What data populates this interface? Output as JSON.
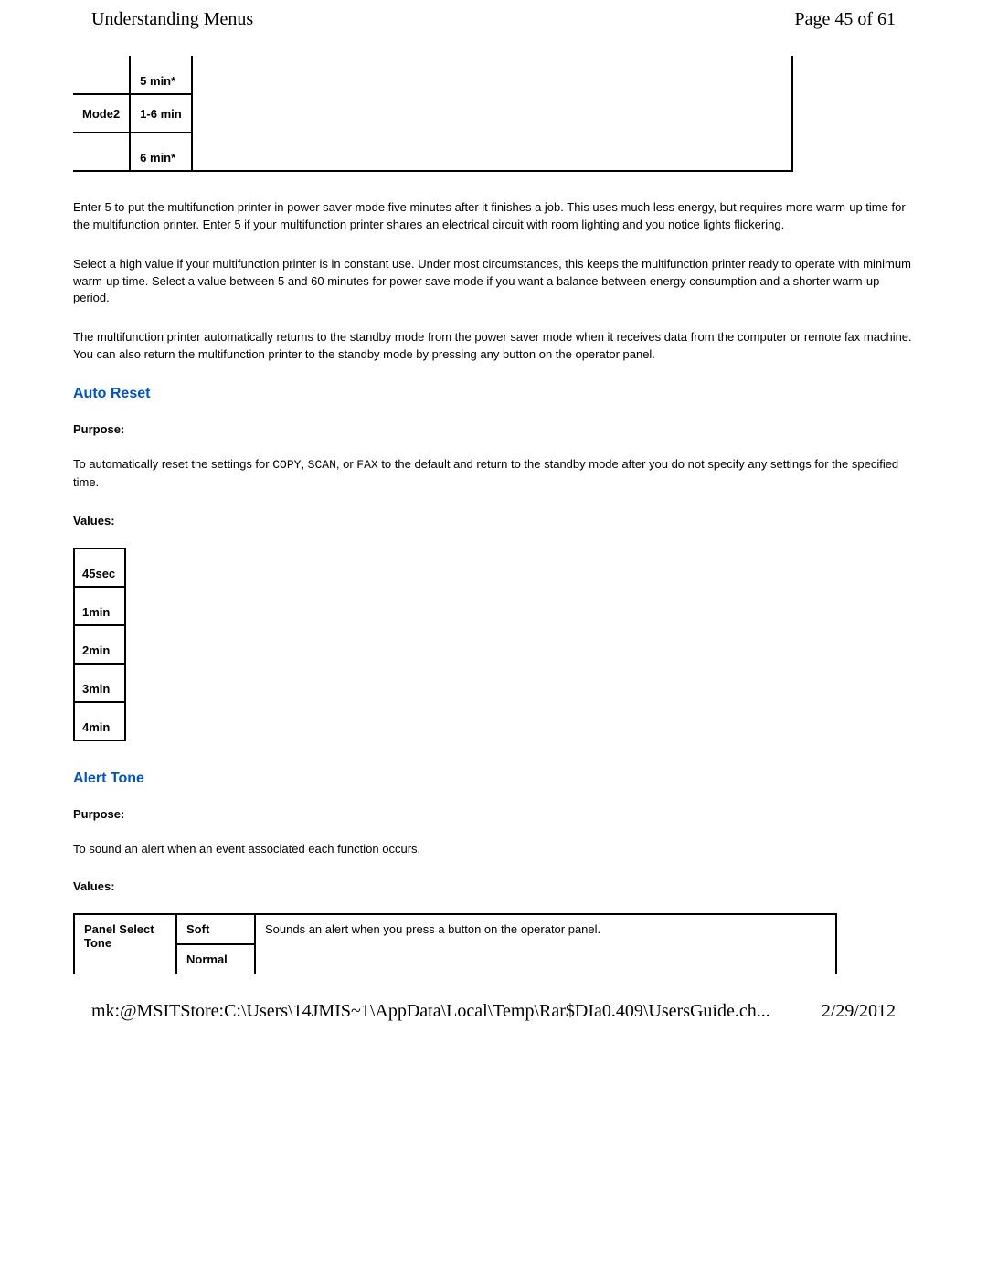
{
  "header": {
    "title": "Understanding Menus",
    "page_indicator": "Page 45 of 61"
  },
  "power_table": {
    "r1c2": "5 min*",
    "r2c1": "Mode2",
    "r2c2": "1-6 min",
    "r3c2": "6 min*"
  },
  "para1": "Enter 5 to put the multifunction printer in power saver mode five minutes after it finishes a job. This uses much less energy, but requires more warm-up time for the multifunction printer. Enter 5 if your multifunction printer shares an electrical circuit with room lighting and you notice lights flickering.",
  "para2": "Select a high value if your multifunction printer is in constant use. Under most circumstances, this keeps the multifunction printer ready to operate with minimum warm-up time. Select a value between 5 and 60 minutes for power save mode if you want a balance between energy consumption and a shorter warm-up period.",
  "para3": "The multifunction printer automatically returns to the standby mode from the power saver mode when it receives data from the computer or remote fax machine. You can also return the multifunction printer to the standby mode by pressing any button on the operator panel.",
  "auto_reset": {
    "title": "Auto Reset",
    "purpose_label": "Purpose:",
    "purpose_text_pre": "To automatically reset the settings for ",
    "copy": "COPY",
    "sep1": ", ",
    "scan": "SCAN",
    "sep2": ", or ",
    "fax": "FAX",
    "purpose_text_post": " to the default and return to the standby mode after you do not specify any settings for the specified time.",
    "values_label": "Values:",
    "values": [
      "45sec",
      "1min",
      "2min",
      "3min",
      "4min"
    ]
  },
  "alert_tone": {
    "title": "Alert Tone",
    "purpose_label": "Purpose:",
    "purpose_text": "To sound an alert when an event associated each function occurs.",
    "values_label": "Values:",
    "row1_label": "Panel Select Tone",
    "soft": "Soft",
    "normal": "Normal",
    "desc": "Sounds an alert when you press a button on the operator panel."
  },
  "footer": {
    "path": "mk:@MSITStore:C:\\Users\\14JMIS~1\\AppData\\Local\\Temp\\Rar$DIa0.409\\UsersGuide.ch...",
    "date": "2/29/2012"
  }
}
